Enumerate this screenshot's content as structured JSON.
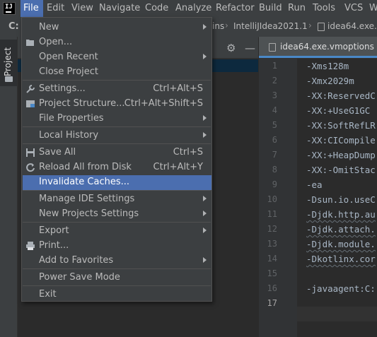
{
  "menubar": {
    "items": [
      {
        "label": "File",
        "mnemonic": "F",
        "rest": "ile"
      },
      {
        "label": "Edit",
        "mnemonic": "E",
        "rest": "dit"
      },
      {
        "label": "View",
        "mnemonic": "V",
        "rest": "iew"
      },
      {
        "label": "Navigate",
        "mnemonic": "N",
        "rest": "avigate"
      },
      {
        "label": "Code",
        "mnemonic": "C",
        "rest": "ode"
      },
      {
        "label": "Analyze",
        "pre": "Analy",
        "mnemonic": "z",
        "rest": "e"
      },
      {
        "label": "Refactor",
        "mnemonic": "R",
        "rest": "efactor"
      },
      {
        "label": "Build",
        "mnemonic": "B",
        "rest": "uild"
      },
      {
        "label": "Run",
        "pre": "R",
        "mnemonic": "u",
        "rest": "n"
      },
      {
        "label": "Tools",
        "mnemonic": "T",
        "rest": "ools"
      },
      {
        "label": "VCS",
        "mnemonic": "",
        "rest": "VCS"
      },
      {
        "label": "W",
        "mnemonic": "W",
        "rest": ""
      }
    ]
  },
  "navbar": {
    "project_letter": "C:",
    "crumbs": [
      "ins",
      "IntelliJIdea2021.1",
      "idea64.exe.v"
    ]
  },
  "sidebar": {
    "project_tab": "Project"
  },
  "editor": {
    "tab_label": "idea64.exe.vmoptions",
    "lines": [
      {
        "n": "1",
        "text": "-Xms128m",
        "warn": false
      },
      {
        "n": "2",
        "text": "-Xmx2029m",
        "warn": false
      },
      {
        "n": "3",
        "text": "-XX:ReservedC",
        "warn": false
      },
      {
        "n": "4",
        "text": "-XX:+UseG1GC",
        "warn": false
      },
      {
        "n": "5",
        "text": "-XX:SoftRefLR",
        "warn": false
      },
      {
        "n": "6",
        "text": "-XX:CICompile",
        "warn": false
      },
      {
        "n": "7",
        "text": "-XX:+HeapDump",
        "warn": false
      },
      {
        "n": "8",
        "text": "-XX:-OmitStac",
        "warn": false
      },
      {
        "n": "9",
        "text": "-ea",
        "warn": false
      },
      {
        "n": "10",
        "text": "-Dsun.io.useC",
        "warn": false
      },
      {
        "n": "11",
        "text": "-Djdk.http.au",
        "warn": true
      },
      {
        "n": "12",
        "text": "-Djdk.attach.",
        "warn": true
      },
      {
        "n": "13",
        "text": "-Djdk.module.",
        "warn": true
      },
      {
        "n": "14",
        "text": "-Dkotlinx.cor",
        "warn": true
      },
      {
        "n": "15",
        "text": "",
        "warn": false
      },
      {
        "n": "16",
        "text": "-javaagent:C:",
        "warn": false
      },
      {
        "n": "17",
        "text": "",
        "warn": false
      }
    ]
  },
  "file_menu": {
    "items": [
      {
        "label": "New",
        "shortcut": "",
        "arrow": true,
        "icon": ""
      },
      {
        "label": "Open...",
        "shortcut": "",
        "arrow": false,
        "icon": "folder-open-icon"
      },
      {
        "label": "Open Recent",
        "shortcut": "",
        "arrow": true,
        "icon": ""
      },
      {
        "label": "Close Project",
        "shortcut": "",
        "arrow": false,
        "icon": ""
      },
      {
        "label": "Settings...",
        "shortcut": "Ctrl+Alt+S",
        "arrow": false,
        "icon": "wrench-icon"
      },
      {
        "label": "Project Structure...",
        "shortcut": "Ctrl+Alt+Shift+S",
        "arrow": false,
        "icon": "project-structure-icon"
      },
      {
        "label": "File Properties",
        "shortcut": "",
        "arrow": true,
        "icon": ""
      },
      {
        "label": "Local History",
        "shortcut": "",
        "arrow": true,
        "icon": ""
      },
      {
        "label": "Save All",
        "shortcut": "Ctrl+S",
        "arrow": false,
        "icon": "save-icon"
      },
      {
        "label": "Reload All from Disk",
        "shortcut": "Ctrl+Alt+Y",
        "arrow": false,
        "icon": "reload-icon"
      },
      {
        "label": "Invalidate Caches...",
        "shortcut": "",
        "arrow": false,
        "icon": "",
        "highlighted": true
      },
      {
        "label": "Manage IDE Settings",
        "shortcut": "",
        "arrow": true,
        "icon": ""
      },
      {
        "label": "New Projects Settings",
        "shortcut": "",
        "arrow": true,
        "icon": ""
      },
      {
        "label": "Export",
        "shortcut": "",
        "arrow": true,
        "icon": ""
      },
      {
        "label": "Print...",
        "shortcut": "",
        "arrow": false,
        "icon": "print-icon"
      },
      {
        "label": "Add to Favorites",
        "shortcut": "",
        "arrow": true,
        "icon": ""
      },
      {
        "label": "Power Save Mode",
        "shortcut": "",
        "arrow": false,
        "icon": ""
      },
      {
        "label": "Exit",
        "shortcut": "",
        "arrow": false,
        "icon": ""
      }
    ]
  }
}
